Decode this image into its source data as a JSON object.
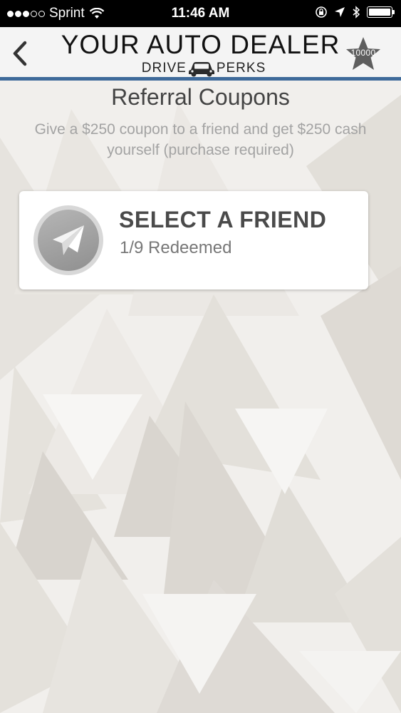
{
  "status_bar": {
    "carrier": "Sprint",
    "time": "11:46 AM",
    "signal_bars_filled": 3,
    "signal_bars_total": 5
  },
  "header": {
    "title": "YOUR AUTO DEALER",
    "subtitle_left": "DRIVE",
    "subtitle_right": "PERKS",
    "points": "10000",
    "accent_color": "#3e6a9a"
  },
  "page": {
    "title": "Referral Coupons",
    "description": "Give a $250 coupon to a friend and get $250 cash yourself (purchase required)"
  },
  "friend_card": {
    "title": "SELECT A FRIEND",
    "status": "1/9 Redeemed",
    "icon": "paper-plane-icon"
  }
}
